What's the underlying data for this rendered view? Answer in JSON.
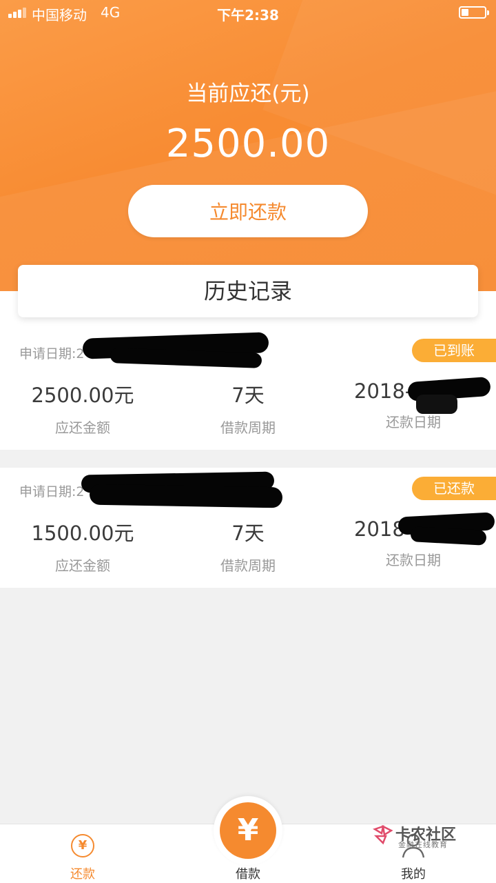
{
  "status_bar": {
    "carrier": "中国移动",
    "network": "4G",
    "time": "下午2:38"
  },
  "hero": {
    "due_label": "当前应还(元)",
    "due_amount": "2500.00",
    "repay_button": "立即还款"
  },
  "history": {
    "title": "历史记录",
    "records": [
      {
        "apply_date_label": "申请日期:2",
        "status": "已到账",
        "amount": "2500.00元",
        "amount_label": "应还金额",
        "period": "7天",
        "period_label": "借款周期",
        "repay_date": "2018-",
        "repay_date_label": "还款日期"
      },
      {
        "apply_date_label": "申请日期:2",
        "status": "已还款",
        "amount": "1500.00元",
        "amount_label": "应还金额",
        "period": "7天",
        "period_label": "借款周期",
        "repay_date": "2018",
        "repay_date_label": "还款日期"
      }
    ]
  },
  "tabbar": {
    "tabs": [
      {
        "label": "还款",
        "icon": "yen-circle-icon"
      },
      {
        "label": "借款",
        "icon": "yen-icon"
      },
      {
        "label": "我的",
        "icon": "person-icon"
      }
    ],
    "yen_symbol": "¥"
  },
  "watermark": {
    "title": "卡农社区",
    "subtitle": "金融在线教育"
  },
  "colors": {
    "accent": "#f58a2f",
    "badge": "#fbad36",
    "background": "#f1f1f1"
  }
}
